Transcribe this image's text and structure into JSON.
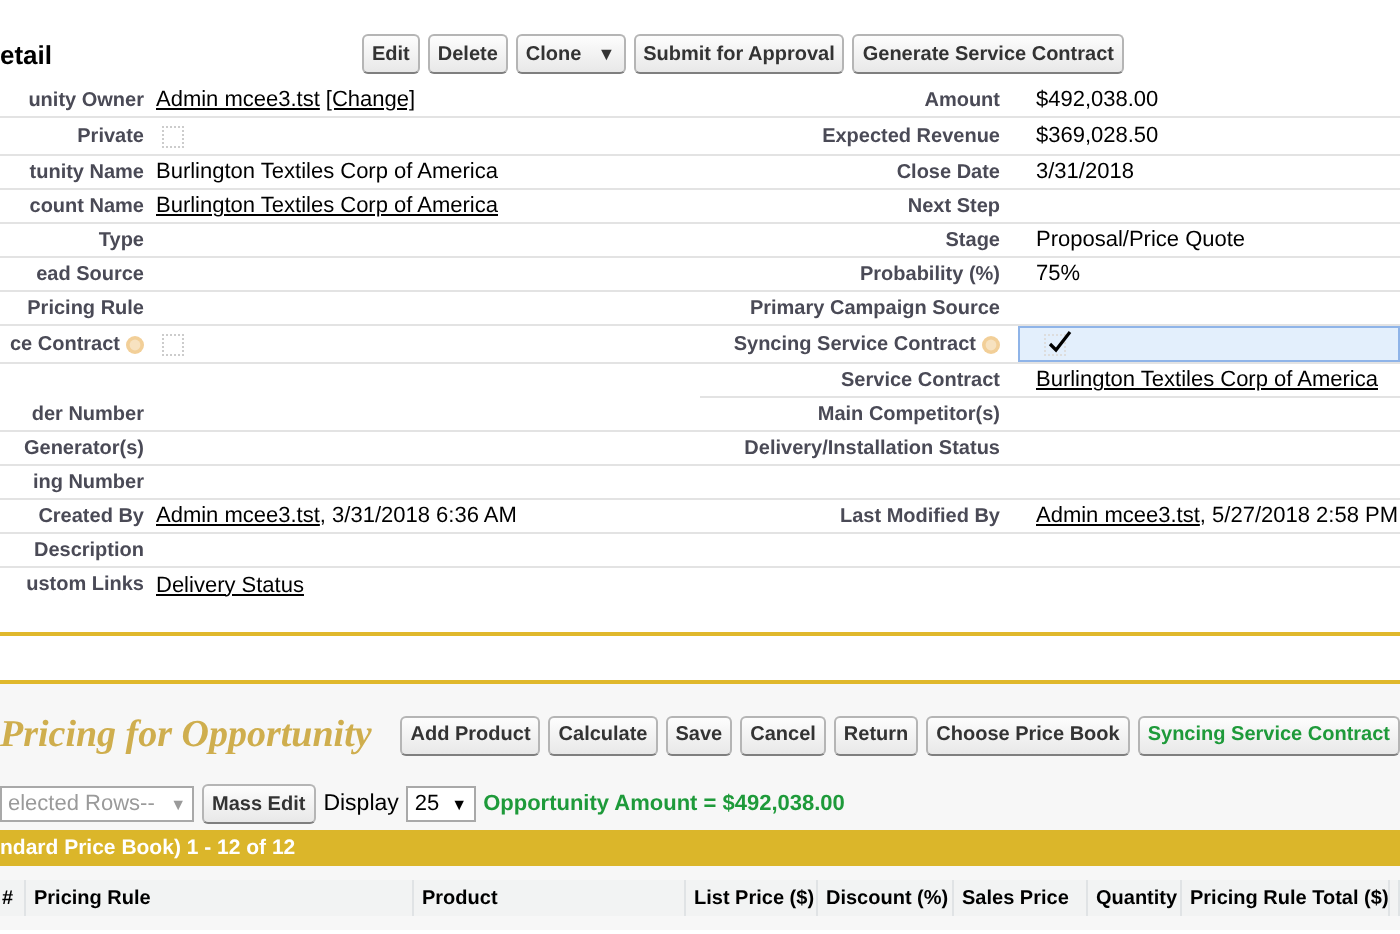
{
  "detail": {
    "title": "etail",
    "buttons": [
      {
        "label": "Edit"
      },
      {
        "label": "Delete"
      },
      {
        "label": "Clone",
        "caret": "▼"
      },
      {
        "label": "Submit for Approval"
      },
      {
        "label": "Generate Service Contract"
      }
    ],
    "rows": [
      {
        "left": {
          "label": "unity Owner",
          "kind": "text",
          "parts": [
            {
              "text": "Admin mcee3.tst",
              "link": true
            },
            {
              "text": "[Change]",
              "link": true
            }
          ]
        },
        "right": {
          "label": "Amount",
          "kind": "text",
          "parts": [
            {
              "text": "$492,038.00",
              "link": false
            }
          ]
        }
      },
      {
        "left": {
          "label": "Private",
          "kind": "checkbox",
          "checked": false,
          "help": false,
          "highlighted": false
        },
        "right": {
          "label": "Expected Revenue",
          "kind": "text",
          "parts": [
            {
              "text": "$369,028.50",
              "link": false
            }
          ]
        }
      },
      {
        "left": {
          "label": "tunity Name",
          "kind": "text",
          "parts": [
            {
              "text": "Burlington Textiles Corp of America",
              "link": false
            }
          ]
        },
        "right": {
          "label": "Close Date",
          "kind": "text",
          "parts": [
            {
              "text": "3/31/2018",
              "link": false
            }
          ]
        }
      },
      {
        "left": {
          "label": "count Name",
          "kind": "text",
          "parts": [
            {
              "text": "Burlington Textiles Corp of America",
              "link": true
            }
          ]
        },
        "right": {
          "label": "Next Step",
          "kind": "text"
        }
      },
      {
        "left": {
          "label": "Type",
          "kind": "text"
        },
        "right": {
          "label": "Stage",
          "kind": "text",
          "parts": [
            {
              "text": "Proposal/Price Quote",
              "link": false
            }
          ]
        }
      },
      {
        "left": {
          "label": "ead Source",
          "kind": "text"
        },
        "right": {
          "label": "Probability (%)",
          "kind": "text",
          "parts": [
            {
              "text": "75%",
              "link": false
            }
          ]
        }
      },
      {
        "left": {
          "label": "Pricing Rule",
          "kind": "text"
        },
        "right": {
          "label": "Primary Campaign Source",
          "kind": "text"
        }
      },
      {
        "left": {
          "label": "ce Contract",
          "kind": "checkbox",
          "checked": false,
          "help": true,
          "highlighted": false
        },
        "right": {
          "label": "Syncing Service Contract",
          "kind": "checkbox",
          "checked": true,
          "help": true,
          "highlighted": true
        }
      },
      {
        "right": {
          "label": "Service Contract",
          "kind": "text",
          "parts": [
            {
              "text": "Burlington Textiles Corp of America",
              "link": true
            }
          ]
        }
      },
      {
        "left": {
          "label": "der Number",
          "kind": "text"
        },
        "right": {
          "label": "Main Competitor(s)",
          "kind": "text"
        }
      },
      {
        "left": {
          "label": "Generator(s)",
          "kind": "text"
        },
        "right": {
          "label": "Delivery/Installation Status",
          "kind": "text"
        }
      },
      {
        "left": {
          "label": "ing Number",
          "kind": "text"
        },
        "right": {
          "kind": "blank"
        }
      },
      {
        "left": {
          "label": "Created By",
          "kind": "text",
          "parts": [
            {
              "text": "Admin mcee3.tst",
              "link": true
            },
            {
              "text": ", 3/31/2018 6:36 AM",
              "link": false
            }
          ]
        },
        "right": {
          "label": "Last Modified By",
          "kind": "text",
          "parts": [
            {
              "text": "Admin mcee3.tst",
              "link": true
            },
            {
              "text": ", 5/27/2018 2:58 PM",
              "link": false
            }
          ]
        }
      },
      {
        "left": {
          "label": "Description",
          "kind": "text"
        },
        "right": {
          "kind": "blank"
        }
      },
      {
        "left": {
          "label": "ustom Links",
          "kind": "text",
          "parts": [
            {
              "text": "Delivery Status",
              "link": true
            }
          ]
        }
      }
    ]
  },
  "pricing": {
    "title": "Pricing for Opportunity",
    "buttons": [
      {
        "label": "Add Product",
        "kind": "plain"
      },
      {
        "label": "Calculate",
        "kind": "plain"
      },
      {
        "label": "Save",
        "kind": "plain"
      },
      {
        "label": "Cancel",
        "kind": "plain"
      },
      {
        "label": "Return",
        "kind": "plain"
      },
      {
        "label": "Choose Price Book",
        "kind": "plain"
      },
      {
        "label": "Syncing Service Contract",
        "kind": "green"
      }
    ],
    "bulk_select": {
      "value": "elected Rows--",
      "caret": "▼",
      "disabled": true
    },
    "mass_edit": "Mass Edit",
    "display_label": "Display",
    "display_select": {
      "value": "25",
      "caret": "▼",
      "disabled": false
    },
    "amount": "Opportunity Amount = $492,038.00",
    "bar": "ndard Price Book) 1 - 12 of 12",
    "columns": [
      "#",
      "Pricing Rule",
      "Product",
      "List Price ($)",
      "Discount (%)",
      "Sales Price",
      "Quantity",
      "Pricing Rule Total ($)"
    ]
  }
}
